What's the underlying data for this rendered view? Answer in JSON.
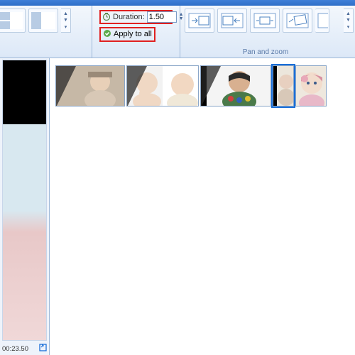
{
  "ribbon": {
    "duration_label": "Duration:",
    "duration_value": "1.50",
    "apply_all_label": "Apply to all",
    "panzoom_group_label": "Pan and zoom"
  },
  "preview": {
    "time_display": "00:23.50"
  },
  "icons": {
    "timer": "timer-icon",
    "check": "check-icon"
  },
  "colors": {
    "highlight": "#e02020",
    "accent": "#1a6fd8"
  }
}
